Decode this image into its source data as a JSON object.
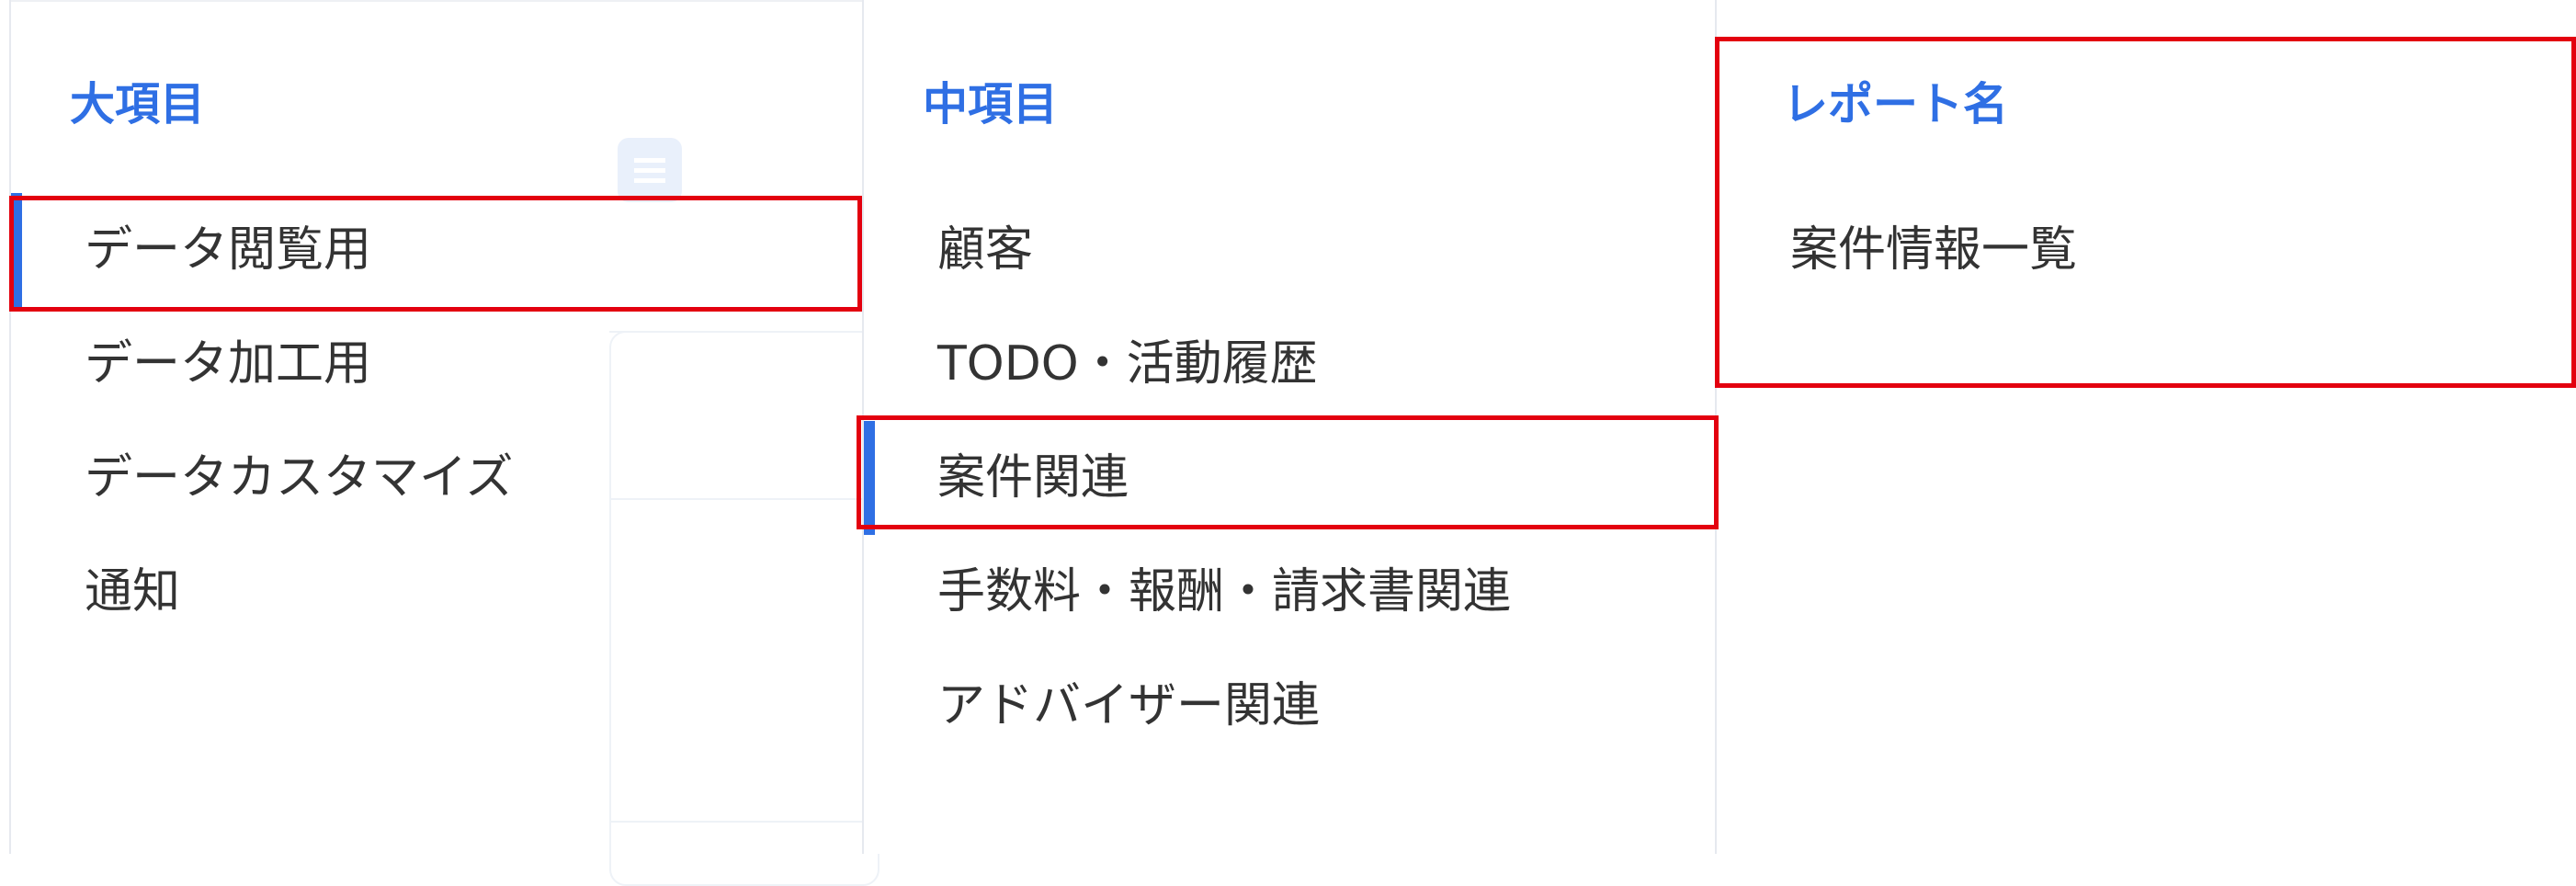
{
  "columns": {
    "major": {
      "header": "大項目",
      "items": [
        {
          "label": "データ閲覧用",
          "selected": true
        },
        {
          "label": "データ加工用",
          "selected": false
        },
        {
          "label": "データカスタマイズ",
          "selected": false
        },
        {
          "label": "通知",
          "selected": false
        }
      ]
    },
    "middle": {
      "header": "中項目",
      "items": [
        {
          "label": "顧客",
          "selected": false
        },
        {
          "label": "TODO・活動履歴",
          "selected": false
        },
        {
          "label": "案件関連",
          "selected": true
        },
        {
          "label": "手数料・報酬・請求書関連",
          "selected": false
        },
        {
          "label": "アドバイザー関連",
          "selected": false
        }
      ]
    },
    "report": {
      "header": "レポート名",
      "items": [
        {
          "label": "案件情報一覧",
          "selected": false
        }
      ]
    }
  },
  "colors": {
    "accent": "#2f6fe4",
    "highlight": "#e3000f",
    "text": "#333333",
    "divider": "#e6e9ef"
  },
  "icons": {
    "background_document": "document-icon"
  }
}
